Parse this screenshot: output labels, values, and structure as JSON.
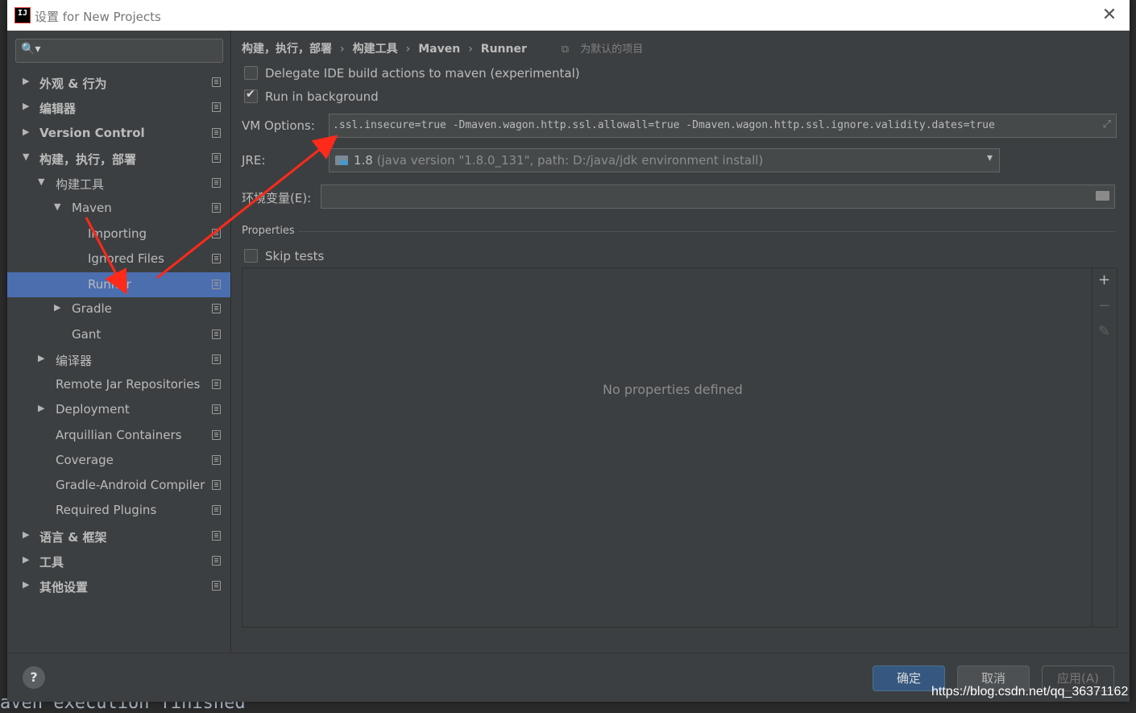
{
  "window": {
    "title": "设置 for New Projects",
    "close_glyph": "✕",
    "app_icon_text": "IJ"
  },
  "background": {
    "bottom_text": "aven execution finished"
  },
  "sidebar": {
    "search_glyph": "🔍▾",
    "items": [
      {
        "label": "外观 & 行为",
        "arrow": "▶"
      },
      {
        "label": "编辑器",
        "arrow": "▶"
      },
      {
        "label": "Version Control",
        "arrow": "▶"
      },
      {
        "label": "构建，执行，部署",
        "arrow": "▼"
      },
      {
        "label": "构建工具",
        "arrow": "▼"
      },
      {
        "label": "Maven",
        "arrow": "▼"
      },
      {
        "label": "Importing",
        "arrow": ""
      },
      {
        "label": "Ignored Files",
        "arrow": ""
      },
      {
        "label": "Runner",
        "arrow": ""
      },
      {
        "label": "Gradle",
        "arrow": "▶"
      },
      {
        "label": "Gant",
        "arrow": ""
      },
      {
        "label": "编译器",
        "arrow": "▶"
      },
      {
        "label": "Remote Jar Repositories",
        "arrow": ""
      },
      {
        "label": "Deployment",
        "arrow": "▶"
      },
      {
        "label": "Arquillian Containers",
        "arrow": ""
      },
      {
        "label": "Coverage",
        "arrow": ""
      },
      {
        "label": "Gradle-Android Compiler",
        "arrow": ""
      },
      {
        "label": "Required Plugins",
        "arrow": ""
      },
      {
        "label": "语言 & 框架",
        "arrow": "▶"
      },
      {
        "label": "工具",
        "arrow": "▶"
      },
      {
        "label": "其他设置",
        "arrow": "▶"
      }
    ]
  },
  "breadcrumb": {
    "items": [
      "构建，执行，部署",
      "构建工具",
      "Maven",
      "Runner"
    ],
    "separator": "›",
    "scope": "为默认的项目",
    "scope_icon": "⧉"
  },
  "options": {
    "delegate_label": "Delegate IDE build actions to maven (experimental)",
    "delegate_checked": false,
    "background_label": "Run in background",
    "background_checked": true,
    "vm_label": "VM Options:",
    "vm_value": ".ssl.insecure=true -Dmaven.wagon.http.ssl.allowall=true -Dmaven.wagon.http.ssl.ignore.validity.dates=true",
    "vm_expand_icon": "⤢",
    "jre_label": "JRE:",
    "jre_version": "1.8",
    "jre_detail": "(java version \"1.8.0_131\", path: D:/java/jdk environment install)",
    "jre_caret": "▾",
    "env_label": "环境变量(E):",
    "env_value": ""
  },
  "properties": {
    "section_title": "Properties",
    "skip_tests_label": "Skip tests",
    "skip_tests_checked": false,
    "empty_text": "No properties defined",
    "add_glyph": "+",
    "remove_glyph": "−",
    "edit_glyph": "✎"
  },
  "footer": {
    "help_glyph": "?",
    "ok_label": "确定",
    "cancel_label": "取消",
    "apply_label": "应用(A)"
  },
  "watermark": "https://blog.csdn.net/qq_36371162"
}
